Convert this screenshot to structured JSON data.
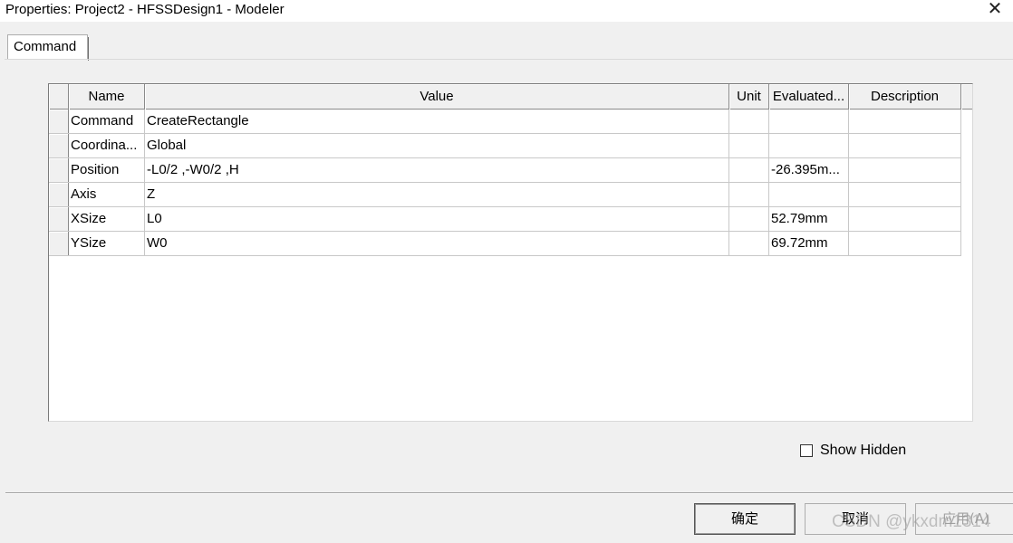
{
  "window": {
    "title": "Properties: Project2 - HFSSDesign1 - Modeler",
    "close_glyph": "✕"
  },
  "tabs": [
    {
      "label": "Command",
      "active": true
    }
  ],
  "grid": {
    "columns": [
      "Name",
      "Value",
      "Unit",
      "Evaluated...",
      "Description"
    ],
    "rows": [
      {
        "name": "Command",
        "value": "CreateRectangle",
        "unit": "",
        "evaluated": "",
        "description": ""
      },
      {
        "name": "Coordina...",
        "value": "Global",
        "unit": "",
        "evaluated": "",
        "description": ""
      },
      {
        "name": "Position",
        "value": "-L0/2 ,-W0/2 ,H",
        "unit": "",
        "evaluated": "-26.395m...",
        "description": ""
      },
      {
        "name": "Axis",
        "value": "Z",
        "unit": "",
        "evaluated": "",
        "description": ""
      },
      {
        "name": "XSize",
        "value": "L0",
        "unit": "",
        "evaluated": "52.79mm",
        "description": ""
      },
      {
        "name": "YSize",
        "value": "W0",
        "unit": "",
        "evaluated": "69.72mm",
        "description": ""
      }
    ]
  },
  "show_hidden": {
    "label": "Show Hidden",
    "checked": false
  },
  "buttons": {
    "ok": "确定",
    "cancel": "取消",
    "apply": "应用(A)"
  },
  "watermark": "CSDN @ykxdm1314"
}
